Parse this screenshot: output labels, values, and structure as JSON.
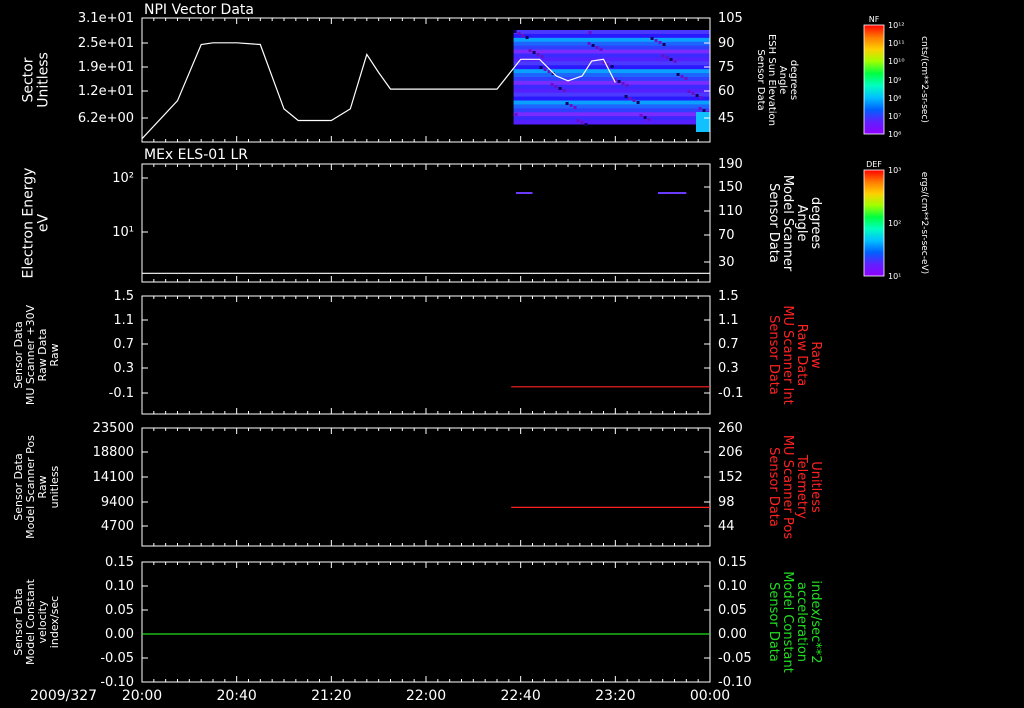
{
  "footer": {
    "date": "2009/327"
  },
  "time_axis": {
    "labels": [
      "20:00",
      "20:40",
      "21:20",
      "22:00",
      "22:40",
      "23:20",
      "00:00"
    ]
  },
  "colorbars": [
    {
      "tag": "NF",
      "unit_label": "cnts/(cm**2-sr-sec)",
      "tick_labels": [
        "10¹²",
        "10¹¹",
        "10¹⁰",
        "10⁹",
        "10⁸",
        "10⁷",
        "10⁶"
      ]
    },
    {
      "tag": "DEF",
      "unit_label": "ergs/(cm**2-sr-sec-eV)",
      "tick_labels": [
        "10³",
        "10²",
        "10¹"
      ]
    }
  ],
  "chart_data": [
    {
      "type": "heatmap",
      "title": "NPI Vector Data",
      "left_label": [
        "Sector",
        "Unitless"
      ],
      "right_label": [
        "Sensor Data",
        "ESH Sun Elevation",
        "Angle",
        "degrees"
      ],
      "left_ticks": [
        "3.1e+01",
        "2.5e+01",
        "1.9e+01",
        "1.2e+01",
        "6.2e+00"
      ],
      "right_ticks": [
        "105",
        "90",
        "75",
        "60",
        "45"
      ],
      "right_ylim": [
        30,
        105
      ],
      "spectrogram_start": "22:37",
      "series": [
        {
          "color": "#ffffff",
          "points": [
            [
              0,
              32
            ],
            [
              15,
              55
            ],
            [
              25,
              89
            ],
            [
              30,
              90
            ],
            [
              40,
              90
            ],
            [
              50,
              89
            ],
            [
              60,
              50
            ],
            [
              66,
              43
            ],
            [
              80,
              43
            ],
            [
              88,
              50
            ],
            [
              95,
              83
            ],
            [
              100,
              72
            ],
            [
              105,
              62
            ],
            [
              115,
              62
            ],
            [
              140,
              62
            ],
            [
              150,
              62
            ],
            [
              160,
              80
            ],
            [
              168,
              80
            ],
            [
              175,
              70
            ],
            [
              180,
              67
            ],
            [
              186,
              70
            ],
            [
              190,
              79
            ],
            [
              195,
              80
            ],
            [
              200,
              66
            ]
          ]
        }
      ]
    },
    {
      "type": "line",
      "title": "MEx ELS-01 LR",
      "left_label": [
        "Electron Energy",
        "eV"
      ],
      "right_label": [
        "Sensor Data",
        "Model Scanner",
        "Angle",
        "degrees"
      ],
      "left_ticks": [
        "10²",
        "10¹"
      ],
      "right_ticks": [
        "190",
        "150",
        "110",
        "70",
        "30"
      ],
      "right_ylim": [
        0,
        190
      ],
      "series": [
        {
          "color": "#ffffff",
          "points": [
            [
              0,
              14
            ],
            [
              240,
              14
            ]
          ]
        }
      ]
    },
    {
      "type": "line",
      "left_label": [
        "Sensor Data",
        "MU Scanner +30V",
        "Raw Data",
        "Raw"
      ],
      "right_label": [
        "Sensor Data",
        "MU Scanner Int",
        "Raw Data",
        "Raw"
      ],
      "left_ticks": [
        "1.5",
        "1.1",
        "0.7",
        "0.3",
        "-0.1"
      ],
      "right_ticks": [
        "1.5",
        "1.1",
        "0.7",
        "0.3",
        "-0.1"
      ],
      "right_ylim": [
        -0.45,
        1.5
      ],
      "series": [
        {
          "color": "#ff2222",
          "points": [
            [
              156,
              0.0
            ],
            [
              240,
              0.0
            ]
          ]
        }
      ]
    },
    {
      "type": "line",
      "left_label": [
        "Sensor Data",
        "Model Scanner Pos",
        "Raw",
        "unitless"
      ],
      "right_label": [
        "Sensor Data",
        "MU Scanner Pos",
        "Telemetry",
        "Unitless"
      ],
      "left_ticks": [
        "23500",
        "18800",
        "14100",
        "9400",
        "4700"
      ],
      "right_ticks": [
        "260",
        "206",
        "152",
        "98",
        "44"
      ],
      "right_ylim": [
        0,
        260
      ],
      "series": [
        {
          "color": "#ff2222",
          "points": [
            [
              156,
              85
            ],
            [
              240,
              85
            ]
          ]
        }
      ]
    },
    {
      "type": "line",
      "left_label": [
        "Sensor Data",
        "Model Constant",
        "velocity",
        "index/sec"
      ],
      "right_label": [
        "Sensor Data",
        "Model Constant",
        "acceleration",
        "index/sec**2"
      ],
      "left_ticks": [
        "0.15",
        "0.10",
        "0.05",
        "0.00",
        "-0.05",
        "-0.10"
      ],
      "right_ticks": [
        "0.15",
        "0.10",
        "0.05",
        "0.00",
        "-0.05",
        "-0.10"
      ],
      "right_ylim": [
        -0.1,
        0.15
      ],
      "series": [
        {
          "color": "#22dd22",
          "points": [
            [
              0,
              0.0
            ],
            [
              240,
              0.0
            ]
          ]
        }
      ]
    }
  ]
}
